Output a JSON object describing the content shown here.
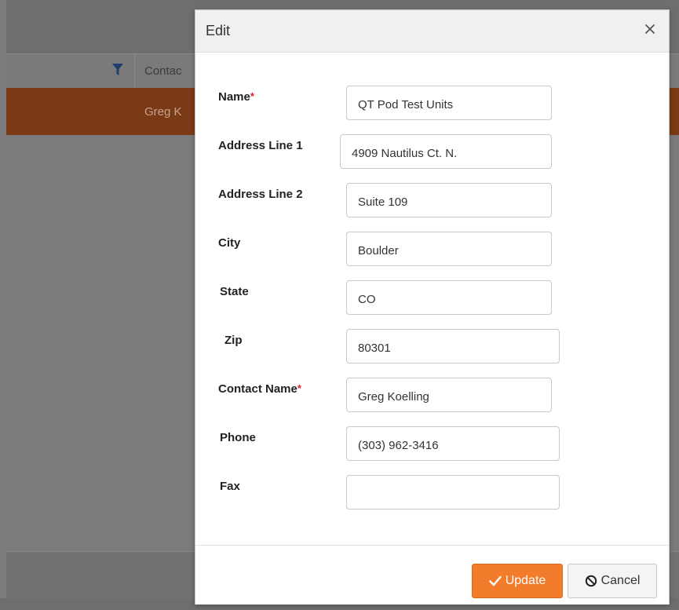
{
  "background_grid": {
    "contact_header": "Contac",
    "selected_row_contact": "Greg K",
    "selected_row_color": "#8b3e12"
  },
  "dialog": {
    "title": "Edit",
    "close_icon": "close-icon",
    "fields": {
      "name": {
        "label": "Name",
        "required": true,
        "value": "QT Pod Test Units"
      },
      "address1": {
        "label": "Address Line 1",
        "required": false,
        "value": "4909 Nautilus Ct. N."
      },
      "address2": {
        "label": "Address Line 2",
        "required": false,
        "value": "Suite 109"
      },
      "city": {
        "label": "City",
        "required": false,
        "value": "Boulder"
      },
      "state": {
        "label": "State",
        "required": false,
        "value": "CO"
      },
      "zip": {
        "label": "Zip",
        "required": false,
        "value": "80301"
      },
      "contact_name": {
        "label": "Contact Name",
        "required": true,
        "value": "Greg Koelling"
      },
      "phone": {
        "label": "Phone",
        "required": false,
        "value": "(303) 962-3416"
      },
      "fax": {
        "label": "Fax",
        "required": false,
        "value": ""
      }
    },
    "required_marker": "*",
    "buttons": {
      "update": {
        "label": "Update",
        "icon": "checkmark-icon",
        "color": "#f27c2b"
      },
      "cancel": {
        "label": "Cancel",
        "icon": "cancel-circle-icon"
      }
    }
  }
}
